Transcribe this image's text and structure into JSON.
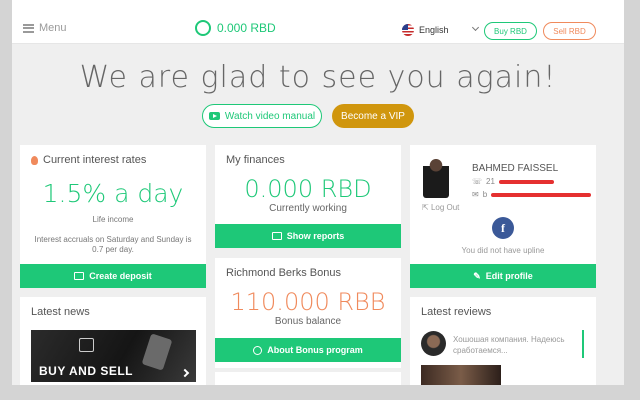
{
  "header": {
    "menu_label": "Menu",
    "balance": "0.000 RBD",
    "language": "English",
    "buy_label": "Buy RBD",
    "sell_label": "Sell RBD"
  },
  "hero": {
    "title": "We are glad to see you again!",
    "video_label": "Watch video manual",
    "vip_label": "Become a VIP"
  },
  "interest": {
    "title": "Current interest rates",
    "rate": "1.5% a day",
    "rate_caption": "Life income",
    "note": "Interest accruals on Saturday and Sunday is 0.7 per day.",
    "button": "Create deposit"
  },
  "finances": {
    "title": "My finances",
    "amount": "0.000 RBD",
    "caption": "Currently working",
    "button": "Show reports"
  },
  "bonus": {
    "title": "Richmond Berks Bonus",
    "amount": "110.000 RBB",
    "caption": "Bonus balance",
    "button": "About Bonus program"
  },
  "profile": {
    "name": "BAHMED FAISSEL",
    "phone_prefix": "21",
    "email_prefix": "b",
    "logout": "Log Out",
    "upline": "You did not have upline",
    "button": "Edit profile",
    "facebook_icon": "f"
  },
  "news": {
    "title": "Latest news",
    "image_caption": "BUY AND SELL"
  },
  "reviews": {
    "title": "Latest reviews",
    "text": "Хошошая компания. Надеюсь сработаемся..."
  },
  "colors": {
    "green": "#1ec878",
    "orange": "#f08a5c",
    "gold": "#d0960d",
    "facebook": "#3b5998"
  }
}
